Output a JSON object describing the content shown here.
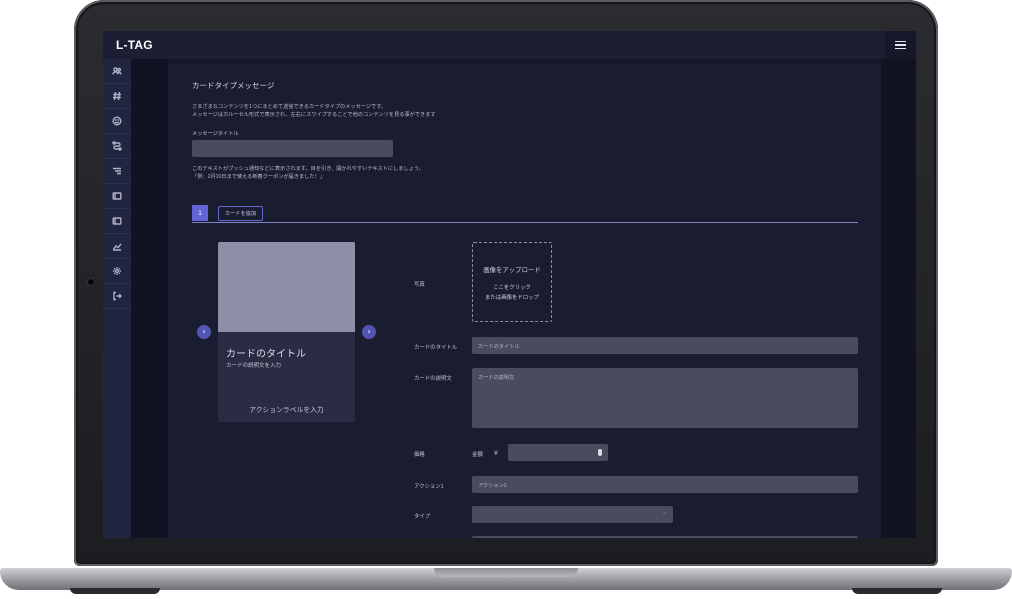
{
  "app": {
    "logo": "L-TAG"
  },
  "sidebar": {
    "items": [
      {
        "icon": "users-icon"
      },
      {
        "icon": "hashtag-icon"
      },
      {
        "icon": "smile-icon"
      },
      {
        "icon": "route-icon"
      },
      {
        "icon": "menu-list-icon"
      },
      {
        "icon": "panel-icon"
      },
      {
        "icon": "panel-icon-2"
      },
      {
        "icon": "chart-icon"
      },
      {
        "icon": "gear-icon"
      },
      {
        "icon": "logout-icon"
      }
    ]
  },
  "page": {
    "title": "カードタイプメッセージ",
    "description_line1": "さまざまなコンテンツを1つにまとめて送信できるカードタイプのメッセージです。",
    "description_line2": "メッセージはカルーセル形式で表示され、左右にスワイプすることで他のコンテンツを見る事ができます",
    "message_title_label": "メッセージタイトル",
    "message_title_value": "",
    "hint_line1": "このテキストがプッシュ通知などに表示されます。目を引き、開かれやすいテキストにしましょう。",
    "hint_line2": "「例：2月10日まで使える新春クーポンが届きました！」"
  },
  "tabs": {
    "current": "1",
    "add_label": "カードを追加"
  },
  "card_preview": {
    "title": "カードのタイトル",
    "description": "カードの説明文を入力",
    "action": "アクションラベルを入力",
    "prev": "‹",
    "next": "›"
  },
  "form": {
    "photo_label": "写真",
    "upload_title": "画像をアップロード",
    "upload_line1": "ここをクリック",
    "upload_line2": "または画像をドロップ",
    "card_title_label": "カードのタイトル",
    "card_title_placeholder": "カードのタイトル",
    "card_desc_label": "カードの説明文",
    "card_desc_placeholder": "カードの説明文",
    "price_label": "価格",
    "amount_label": "金額",
    "currency": "¥",
    "action1_label": "アクション1",
    "action1_placeholder": "アクション1",
    "type_label": "タイプ",
    "type_value": ""
  },
  "colors": {
    "accent": "#6264d8",
    "background": "#161828",
    "panel": "#1a1c30",
    "sidebar": "#222540"
  }
}
